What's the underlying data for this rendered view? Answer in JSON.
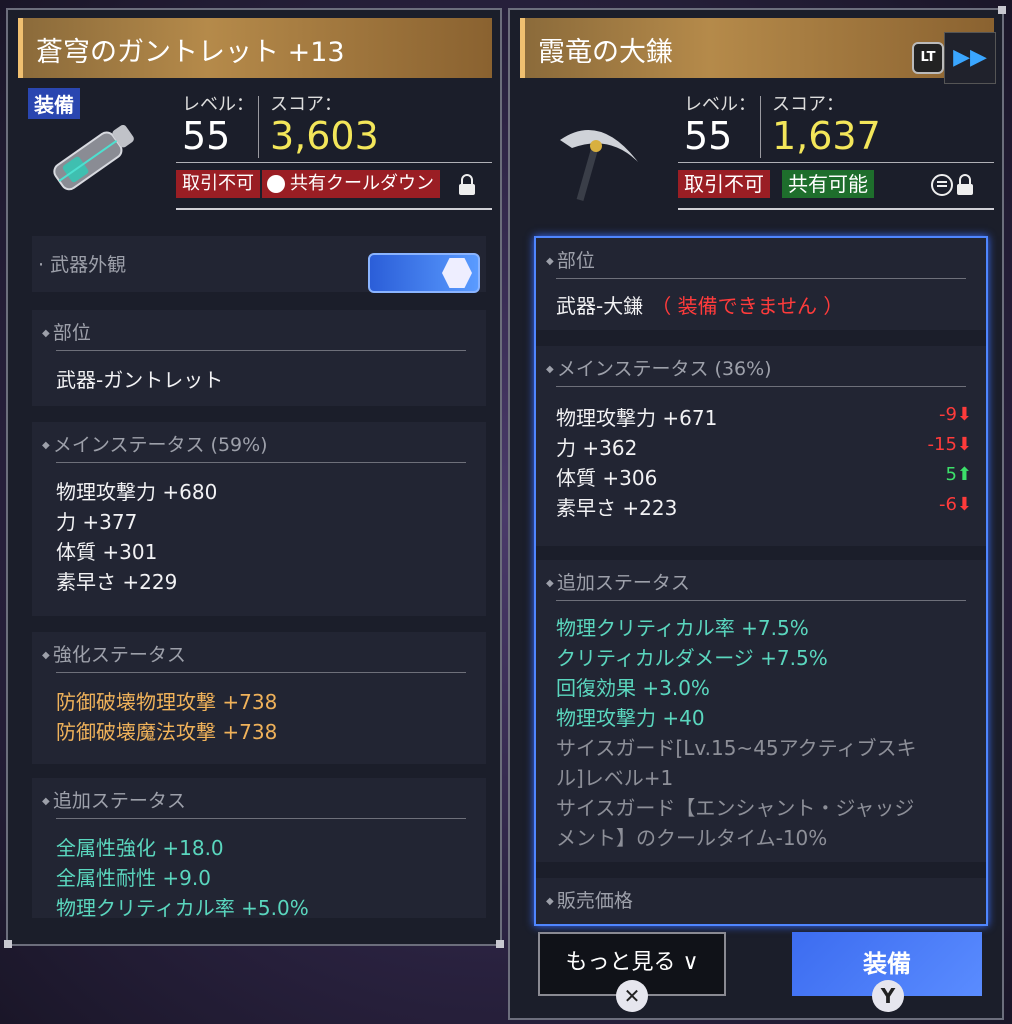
{
  "left_item": {
    "title": "蒼穹のガントレット +13",
    "equip_tag": "装備",
    "level_label": "レベル：",
    "level": "55",
    "score_label": "スコア：",
    "score": "3,603",
    "tags": [
      "取引不可",
      "共有クールダウン"
    ],
    "appearance_label": "武器外観",
    "part_header": "部位",
    "part_value": "武器-ガントレット",
    "main_header": "メインステータス (59%)",
    "main_stats": [
      "物理攻撃力 +680",
      "力 +377",
      "体質 +301",
      "素早さ +229"
    ],
    "enh_header": "強化ステータス",
    "enh_stats": [
      "防御破壊物理攻撃 +738",
      "防御破壊魔法攻撃 +738"
    ],
    "add_header": "追加ステータス",
    "add_stats": [
      "全属性強化 +18.0",
      "全属性耐性 +9.0",
      "物理クリティカル率 +5.0%"
    ]
  },
  "right_item": {
    "title": "霞竜の大鎌",
    "lt_label": "LT",
    "ff_icon": "fast-forward-icon",
    "level_label": "レベル：",
    "level": "55",
    "score_label": "スコア：",
    "score": "1,637",
    "tags": [
      "取引不可",
      "共有可能"
    ],
    "part_header": "部位",
    "part_value": "武器-大鎌",
    "part_warning": "（ 装備できません ）",
    "main_header": "メインステータス (36%)",
    "main_stats": [
      {
        "label": "物理攻撃力 +671",
        "diff": "-9",
        "dir": "down"
      },
      {
        "label": "力 +362",
        "diff": "-15",
        "dir": "down"
      },
      {
        "label": "体質 +306",
        "diff": "5",
        "dir": "up"
      },
      {
        "label": "素早さ +223",
        "diff": "-6",
        "dir": "down"
      }
    ],
    "add_header": "追加ステータス",
    "add_stats": [
      "物理クリティカル率 +7.5%",
      "クリティカルダメージ +7.5%",
      "回復効果 +3.0%",
      "物理攻撃力 +40"
    ],
    "add_gray": [
      "サイスガード[Lv.15~45アクティブスキ",
      "ル]レベル+1",
      "サイスガード【エンシャント・ジャッジ",
      "メント】のクールタイム-10%"
    ],
    "sell_header": "販売価格",
    "more_button": "もっと見る",
    "equip_button": "装備",
    "x_glyph": "✕",
    "y_glyph": "Y"
  },
  "colors": {
    "accent_blue": "#4f86ff",
    "score_yellow": "#f3e65a",
    "stat_teal": "#5ad6be",
    "stat_orange": "#f0b25a",
    "down_red": "#ff3b3b",
    "up_green": "#3ce06a"
  }
}
